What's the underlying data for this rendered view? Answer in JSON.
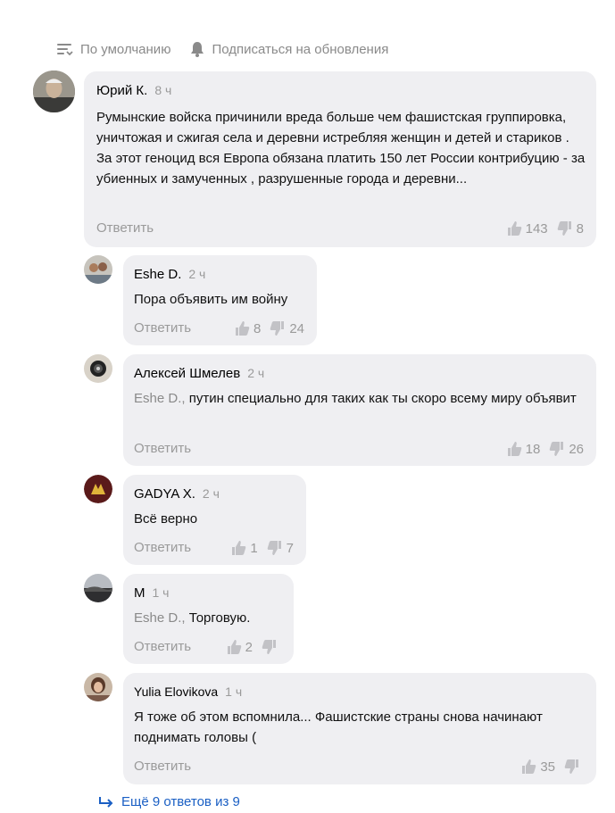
{
  "toolbar": {
    "sort_label": "По умолчанию",
    "subscribe_label": "Подписаться на обновления"
  },
  "comments": [
    {
      "author": "Юрий К.",
      "time": "8 ч",
      "text": "Румынские войска причинили вреда больше чем фашистская группировка, уничтожая и сжигая села и деревни истребляя женщин и детей и стариков . За этот геноцид вся Европа обязана платить 150 лет России контрибуцию - за убиенных и замученных , разрушенные города и деревни...",
      "mention": "",
      "reply_label": "Ответить",
      "likes": "143",
      "dislikes": "8"
    },
    {
      "author": "Eshe D.",
      "time": "2 ч",
      "text": "Пора объявить им войну",
      "mention": "",
      "reply_label": "Ответить",
      "likes": "8",
      "dislikes": "24"
    },
    {
      "author": "Алексей Шмелев",
      "time": "2 ч",
      "mention": "Eshe D.,",
      "text": "путин специально для таких как ты скоро всему миру объявит",
      "reply_label": "Ответить",
      "likes": "18",
      "dislikes": "26"
    },
    {
      "author": "GADYA X.",
      "time": "2 ч",
      "text": "Всё верно",
      "mention": "",
      "reply_label": "Ответить",
      "likes": "1",
      "dislikes": "7"
    },
    {
      "author": "М",
      "time": "1 ч",
      "mention": "Eshe D.,",
      "text": "Торговую.",
      "reply_label": "Ответить",
      "likes": "2",
      "dislikes": ""
    },
    {
      "author": "Yulia Elovikova",
      "time": "1 ч",
      "text": "Я тоже об этом вспомнила... Фашистские страны снова начинают поднимать головы (",
      "mention": "",
      "reply_label": "Ответить",
      "likes": "35",
      "dislikes": ""
    }
  ],
  "more_replies": "Ещё 9 ответов из 9",
  "colors": {
    "bubble": "#efeff2",
    "muted": "#9a9a9a",
    "link": "#1a5fc4"
  }
}
